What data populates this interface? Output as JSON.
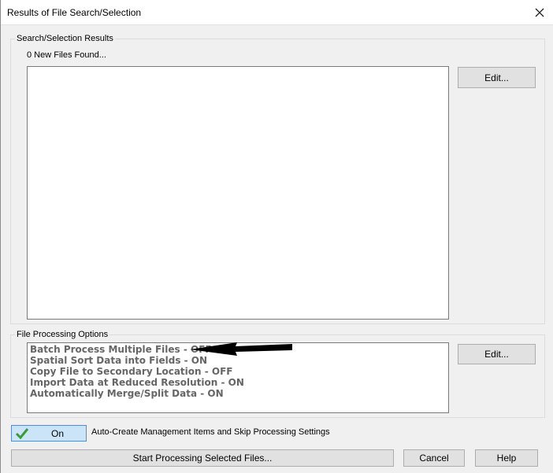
{
  "window": {
    "title": "Results of File Search/Selection"
  },
  "search_group": {
    "label": "Search/Selection Results",
    "status": "0 New Files Found...",
    "edit_label": "Edit..."
  },
  "processing_group": {
    "label": "File Processing Options",
    "options": [
      "Batch Process Multiple Files - OFF",
      "Spatial Sort Data into Fields - ON",
      "Copy File to Secondary Location - OFF",
      "Import Data at Reduced Resolution - ON",
      "Automatically Merge/Split Data - ON"
    ],
    "edit_label": "Edit..."
  },
  "auto_create": {
    "toggle_label": "On",
    "description": "Auto-Create Management Items and Skip Processing Settings"
  },
  "footer": {
    "start_label": "Start Processing Selected Files...",
    "cancel_label": "Cancel",
    "help_label": "Help"
  },
  "icons": {
    "close": "close-icon",
    "check": "check-icon",
    "arrow": "arrow-annotation-icon"
  },
  "colors": {
    "toggle_bg": "#cce4f7",
    "check_green": "#3a9a3a",
    "option_text": "#666666"
  }
}
